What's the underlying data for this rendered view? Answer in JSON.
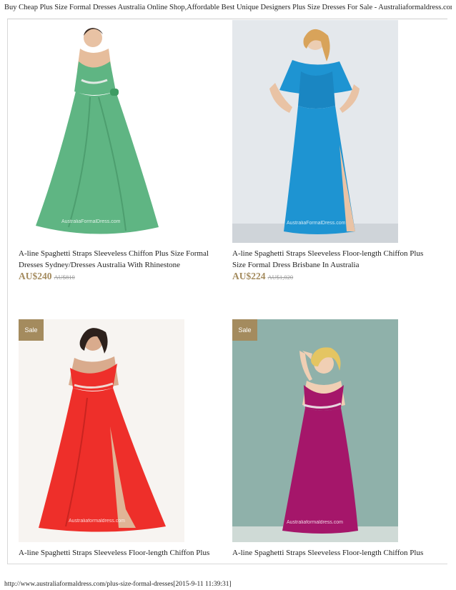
{
  "page": {
    "header_title": "Buy Cheap Plus Size Formal Dresses Australia Online Shop,Affordable Best Unique Designers Plus Size Dresses For Sale - Australiaformaldress.com",
    "footer_url": "http://www.australiaformaldress.com/plus-size-formal-dresses[2015-9-11 11:39:31]"
  },
  "products": [
    {
      "title": "A-line Spaghetti Straps Sleeveless Chiffon Plus Size Formal Dresses Sydney/Dresses Australia With Rhinestone",
      "price": "AU$240",
      "old_price": "AU$810",
      "sale_badge": "",
      "watermark": "AustraliaFormalDress.com",
      "image": {
        "dress_color": "#5fb583",
        "background_color": "#ffffff"
      }
    },
    {
      "title": "A-line Spaghetti Straps Sleeveless Floor-length Chiffon Plus Size Formal Dress Brisbane In Australia",
      "price": "AU$224",
      "old_price": "AU$1,020",
      "sale_badge": "",
      "watermark": "AustraliaFormalDress.com",
      "image": {
        "dress_color": "#1e94d2",
        "background_color": "#e4e8ec"
      }
    },
    {
      "title": "A-line Spaghetti Straps Sleeveless Floor-length Chiffon Plus",
      "sale_badge": "Sale",
      "watermark": "Australiaformaldress.com",
      "image": {
        "dress_color": "#ee2f2a",
        "background_color": "#f7f4f1"
      }
    },
    {
      "title": "A-line Spaghetti Straps Sleeveless Floor-length Chiffon Plus",
      "sale_badge": "Sale",
      "watermark": "Australiaformaldress.com",
      "image": {
        "dress_color": "#a5166a",
        "background_color": "#8fb1aa"
      }
    }
  ]
}
